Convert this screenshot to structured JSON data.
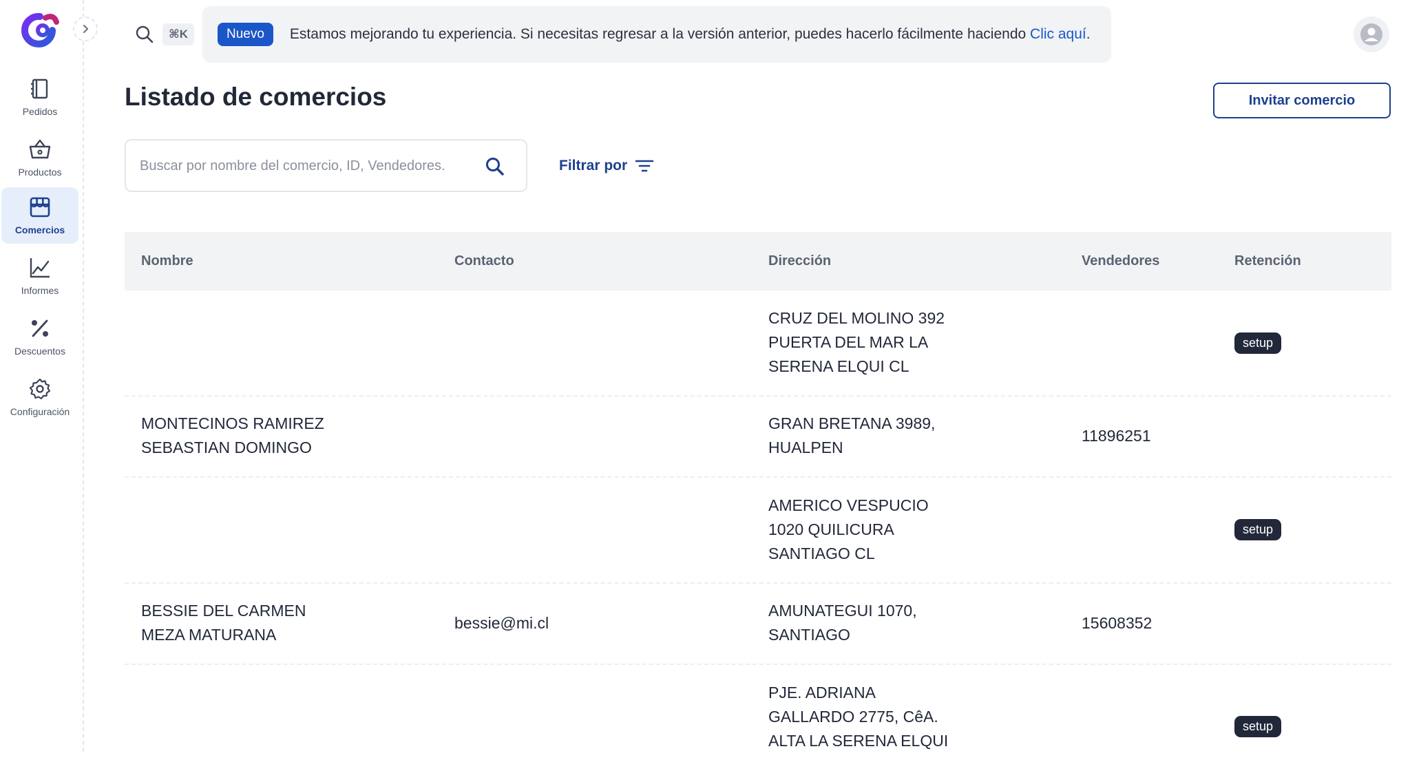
{
  "topbar": {
    "shortcut": "⌘K",
    "banner_badge": "Nuevo",
    "banner_text": "Estamos mejorando tu experiencia. Si necesitas regresar a la versión anterior, puedes hacerlo fácilmente haciendo",
    "banner_link": "Clic aquí",
    "banner_suffix": "."
  },
  "sidebar": {
    "items": [
      {
        "label": "Pedidos",
        "icon": "notebook-icon"
      },
      {
        "label": "Productos",
        "icon": "basket-icon"
      },
      {
        "label": "Comercios",
        "icon": "store-icon",
        "active": true
      },
      {
        "label": "Informes",
        "icon": "chart-line-icon"
      },
      {
        "label": "Descuentos",
        "icon": "percent-icon"
      },
      {
        "label": "Configuración",
        "icon": "gear-icon"
      }
    ]
  },
  "header": {
    "title": "Listado de comercios",
    "invite_label": "Invitar comercio"
  },
  "search": {
    "placeholder": "Buscar por nombre del comercio, ID, Vendedores.",
    "filter_label": "Filtrar por"
  },
  "table": {
    "columns": [
      "Nombre",
      "Contacto",
      "Dirección",
      "Vendedores",
      "Retención"
    ],
    "rows": [
      {
        "nombre": "",
        "contacto": "",
        "direccion": "CRUZ DEL MOLINO 392\nPUERTA DEL MAR LA\nSERENA ELQUI CL",
        "vendedores": "",
        "retencion": "setup"
      },
      {
        "nombre": "MONTECINOS RAMIREZ\nSEBASTIAN DOMINGO",
        "contacto": "",
        "direccion": "GRAN BRETANA 3989,\nHUALPEN",
        "vendedores": "11896251",
        "retencion": ""
      },
      {
        "nombre": "",
        "contacto": "",
        "direccion": "AMERICO VESPUCIO\n1020 QUILICURA\nSANTIAGO CL",
        "vendedores": "",
        "retencion": "setup"
      },
      {
        "nombre": "BESSIE DEL CARMEN\nMEZA MATURANA",
        "contacto": "bessie@mi.cl",
        "direccion": "AMUNATEGUI 1070,\nSANTIAGO",
        "vendedores": "15608352",
        "retencion": ""
      },
      {
        "nombre": "",
        "contacto": "",
        "direccion": "PJE. ADRIANA\nGALLARDO 2775, CêA.\nALTA LA SERENA ELQUI",
        "vendedores": "",
        "retencion": "setup"
      }
    ]
  },
  "colors": {
    "accent": "#1d3f8f",
    "badge": "#1a56c7",
    "active_nav_bg": "#e6eefb",
    "tag_bg": "#22283a"
  }
}
